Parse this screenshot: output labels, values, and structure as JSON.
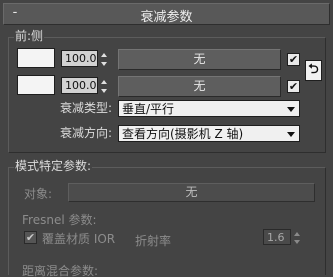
{
  "rollout": {
    "collapse_symbol": "-",
    "title": "衰减参数"
  },
  "front_side": {
    "group_label": "前:侧",
    "rows": [
      {
        "swatch_color": "#f4f4f4",
        "amount": "100.0",
        "map_label": "无",
        "checked": "✔"
      },
      {
        "swatch_color": "#f4f4f4",
        "amount": "100.0",
        "map_label": "无",
        "checked": "✔"
      }
    ],
    "swap_icon": "swap-colors-icon",
    "swap_glyph": "⮌",
    "falloff_type": {
      "label": "衰减类型:",
      "selected": "垂直/平行"
    },
    "falloff_direction": {
      "label": "衰减方向:",
      "selected": "查看方向(摄影机 Z 轴)"
    }
  },
  "mode_specific": {
    "group_label": "模式特定参数:",
    "object": {
      "label": "对象:",
      "button_label": "无"
    },
    "fresnel": {
      "label": "Fresnel 参数:",
      "override_checked": "✔",
      "override_label": "覆盖材质 IOR",
      "ior_label": "折射率",
      "ior_value": "1.6"
    },
    "distance_blend_label": "距离混合参数:"
  }
}
